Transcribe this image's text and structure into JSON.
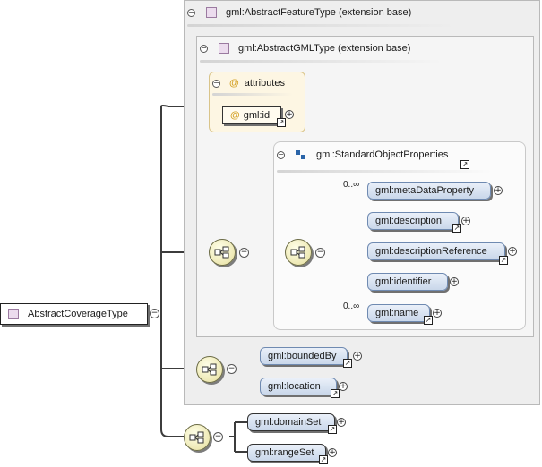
{
  "root": {
    "label": "AbstractCoverageType"
  },
  "feature_base": {
    "title": "gml:AbstractFeatureType (extension base)"
  },
  "gml_base": {
    "title": "gml:AbstractGMLType (extension base)"
  },
  "attributes": {
    "title": "attributes",
    "at_symbol": "@",
    "items": [
      {
        "label": "gml:id"
      }
    ]
  },
  "standard_object": {
    "title": "gml:StandardObjectProperties",
    "elements": [
      {
        "label": "gml:metaDataProperty",
        "cardinality": "0..∞"
      },
      {
        "label": "gml:description"
      },
      {
        "label": "gml:descriptionReference"
      },
      {
        "label": "gml:identifier"
      },
      {
        "label": "gml:name",
        "cardinality": "0..∞"
      }
    ]
  },
  "feature_elements": [
    {
      "label": "gml:boundedBy"
    },
    {
      "label": "gml:location"
    }
  ],
  "coverage_elements": [
    {
      "label": "gml:domainSet"
    },
    {
      "label": "gml:rangeSet"
    }
  ],
  "symbols": {
    "collapse": "−",
    "expand": "+",
    "link": "↗"
  },
  "colors": {
    "element_fill": "#c9d7ea",
    "element_border": "#6f8ab1",
    "attribute_fill": "#fdf6e3",
    "sequence_fill": "#e6df9e",
    "type_icon": "#ecdcee"
  }
}
